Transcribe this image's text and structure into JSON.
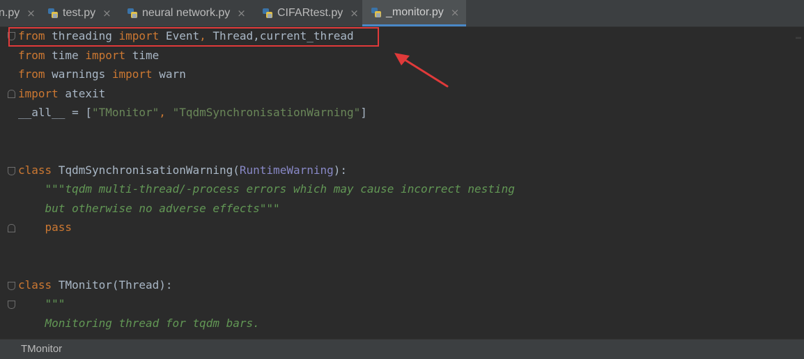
{
  "tabs": [
    {
      "label": "n.py",
      "active": false
    },
    {
      "label": "test.py",
      "active": false
    },
    {
      "label": "neural network.py",
      "active": false
    },
    {
      "label": "CIFARtest.py",
      "active": false
    },
    {
      "label": "_monitor.py",
      "active": true
    }
  ],
  "close_glyph": "×",
  "code": {
    "l1": {
      "a": "from",
      "b": " threading ",
      "c": "import",
      "d": " Event",
      "e": ",",
      "f": " Thread,current_thread"
    },
    "l2": {
      "a": "from",
      "b": " time ",
      "c": "import",
      "d": " time"
    },
    "l3": {
      "a": "from",
      "b": " warnings ",
      "c": "import",
      "d": " warn"
    },
    "l4": {
      "a": "import",
      "b": " atexit"
    },
    "l5": {
      "a": "__all__ = [",
      "b": "\"TMonitor\"",
      "c": ", ",
      "d": "\"TqdmSynchronisationWarning\"",
      "e": "]"
    },
    "l8": {
      "a": "class",
      "b": " TqdmSynchronisationWarning(",
      "c": "RuntimeWarning",
      "d": "):"
    },
    "l9": "    \"\"\"tqdm multi-thread/-process errors which may cause incorrect nesting",
    "l10": "    but otherwise no adverse effects\"\"\"",
    "l11": "    pass",
    "l14": {
      "a": "class",
      "b": " TMonitor(Thread):"
    },
    "l15": "    \"\"\"",
    "l16": "    Monitoring thread for tqdm bars."
  },
  "status": {
    "breadcrumb": "TMonitor"
  },
  "colors": {
    "highlight": "#e03a3a",
    "keyword": "#cc7832",
    "string": "#6a8759",
    "docstring": "#629755"
  }
}
